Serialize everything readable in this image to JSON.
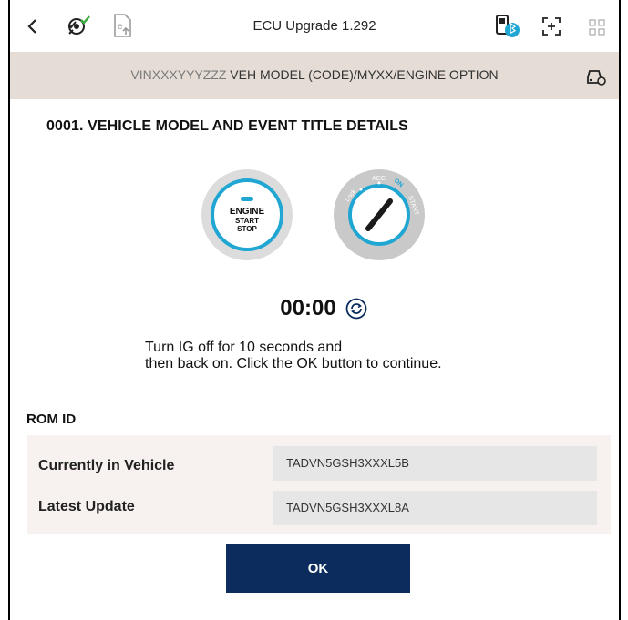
{
  "topbar": {
    "title": "ECU Upgrade 1.292",
    "icons": [
      "back-arrow-icon",
      "vci-settings-check-icon",
      "document-upload-icon",
      "vci-bluetooth-icon",
      "screen-capture-icon",
      "apps-grid-icon"
    ]
  },
  "vinbar": {
    "vin": "VINXXXYYYZZZ",
    "model": " VEH MODEL (CODE)/MYXX/ENGINE OPTION",
    "icon": "vehicle-info-icon"
  },
  "section": {
    "title": "0001. VEHICLE MODEL AND EVENT TITLE DETAILS"
  },
  "engine_button": {
    "line1": "ENGINE",
    "line2": "START",
    "line3": "STOP"
  },
  "ignition": {
    "lock": "Lock",
    "acc": "ACC",
    "on": "ON",
    "start": "START"
  },
  "timer": {
    "value": "00:00"
  },
  "instruction": {
    "line1": "Turn IG off for 10 seconds and",
    "line2": "then back on. Click the OK button to continue."
  },
  "rom": {
    "title": "ROM ID",
    "rows": [
      {
        "label": "Currently in Vehicle",
        "value": "TADVN5GSH3XXXL5B"
      },
      {
        "label": "Latest Update",
        "value": "TADVN5GSH3XXXL8A"
      }
    ]
  },
  "ok_label": "OK",
  "colors": {
    "accent": "#1fa6d3",
    "ok_button": "#0b2c5c",
    "vin_bar": "#e5ddd5",
    "rom_box": "#f7f1ef"
  }
}
